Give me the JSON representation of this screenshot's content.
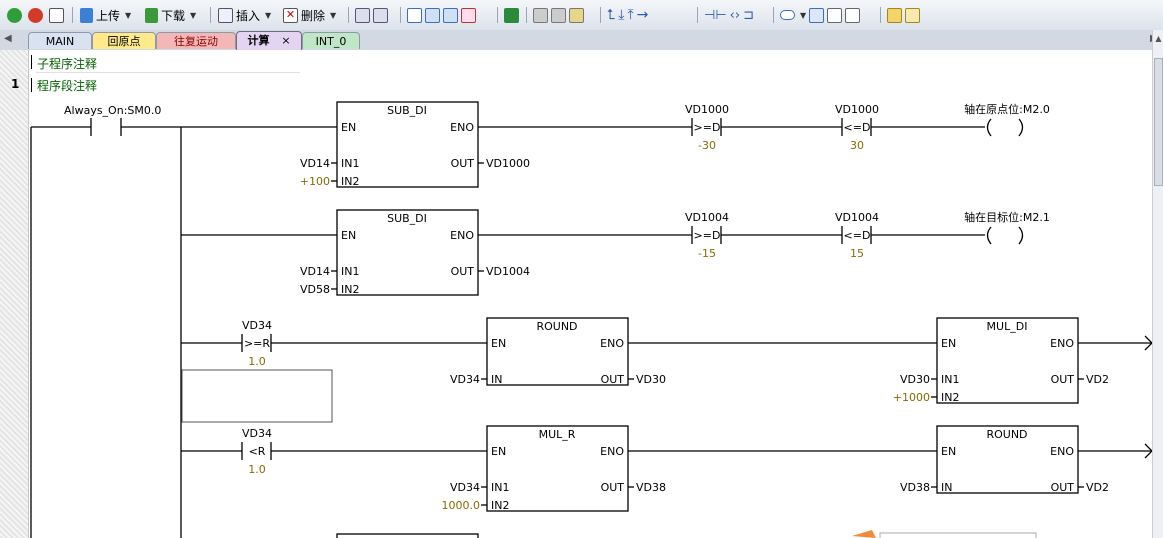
{
  "toolbar": {
    "upload_label": "上传",
    "download_label": "下载",
    "insert_label": "插入",
    "delete_label": "删除"
  },
  "tabs": [
    {
      "label": "MAIN",
      "color": "#d8e2f1"
    },
    {
      "label": "回原点",
      "color": "#ffe98a"
    },
    {
      "label": "往复运动",
      "color": "#f4b7b7"
    },
    {
      "label": "计算",
      "color": "#d8c6ea",
      "active": true,
      "close": "×"
    },
    {
      "label": "INT_0",
      "color": "#bfe7c7"
    }
  ],
  "editor": {
    "subroutine_comment": "子程序注释",
    "network_number": "1",
    "network_comment": "程序段注释"
  },
  "ladder": {
    "contact_always_on": "Always_On:SM0.0",
    "block1": {
      "title": "SUB_DI",
      "en": "EN",
      "eno": "ENO",
      "in1": "IN1",
      "in2": "IN2",
      "out": "OUT",
      "in1_operand": "VD14",
      "in2_operand": "+100",
      "out_operand": "VD1000"
    },
    "block2": {
      "title": "SUB_DI",
      "en": "EN",
      "eno": "ENO",
      "in1": "IN1",
      "in2": "IN2",
      "out": "OUT",
      "in1_operand": "VD14",
      "in2_operand": "VD58",
      "out_operand": "VD1004"
    },
    "cmp1": {
      "operand": "VD1000",
      "op": ">=D",
      "value": "-30"
    },
    "cmp2": {
      "operand": "VD1000",
      "op": "<=D",
      "value": "30"
    },
    "coil1": {
      "label": "轴在原点位:M2.0"
    },
    "cmp3": {
      "operand": "VD1004",
      "op": ">=D",
      "value": "-15"
    },
    "cmp4": {
      "operand": "VD1004",
      "op": "<=D",
      "value": "15"
    },
    "coil2": {
      "label": "轴在目标位:M2.1"
    },
    "cmp5": {
      "operand": "VD34",
      "op": ">=R",
      "value": "1.0"
    },
    "round1": {
      "title": "ROUND",
      "en": "EN",
      "eno": "ENO",
      "in": "IN",
      "out": "OUT",
      "in_operand": "VD34",
      "out_operand": "VD30"
    },
    "mul_di": {
      "title": "MUL_DI",
      "en": "EN",
      "eno": "ENO",
      "in1": "IN1",
      "in2": "IN2",
      "out": "OUT",
      "in1_operand": "VD30",
      "in2_operand": "+1000",
      "out_operand": "VD2"
    },
    "cmp6": {
      "operand": "VD34",
      "op": "<R",
      "value": "1.0"
    },
    "mul_r": {
      "title": "MUL_R",
      "en": "EN",
      "eno": "ENO",
      "in1": "IN1",
      "in2": "IN2",
      "out": "OUT",
      "in1_operand": "VD34",
      "in2_operand": "1000.0",
      "out_operand": "VD38"
    },
    "round2": {
      "title": "ROUND",
      "en": "EN",
      "eno": "ENO",
      "in": "IN",
      "out": "OUT",
      "in_operand": "VD38",
      "out_operand": "VD2"
    }
  },
  "colors": {
    "constant": "#8a6a00",
    "comment": "#006400",
    "wire": "#000000"
  }
}
